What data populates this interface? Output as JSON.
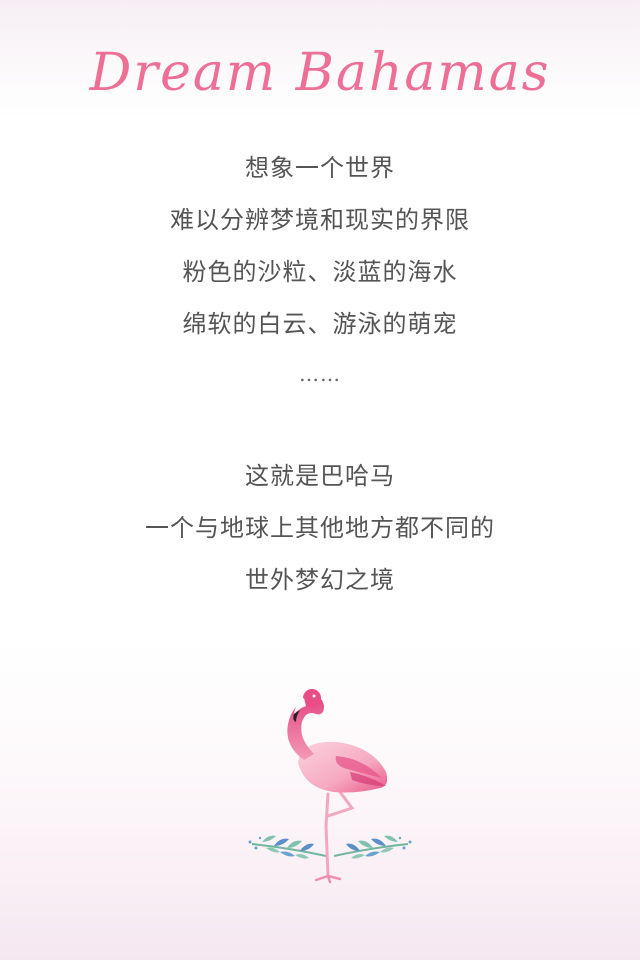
{
  "title": "Dream Bahamas",
  "stanza_1": [
    "想象一个世界",
    "难以分辨梦境和现实的界限",
    "粉色的沙粒、淡蓝的海水",
    "绵软的白云、游泳的萌宠"
  ],
  "ellipsis": "……",
  "stanza_2": [
    "这就是巴哈马",
    "一个与地球上其他地方都不同的",
    "世外梦幻之境"
  ],
  "colors": {
    "title_pink": "#ee6f96",
    "body_text": "#555555",
    "flamingo_pink": "#ef7fa6",
    "leaf_green": "#6fb5a0",
    "leaf_blue": "#5b8fc7"
  },
  "illustration": "flamingo-illustration"
}
